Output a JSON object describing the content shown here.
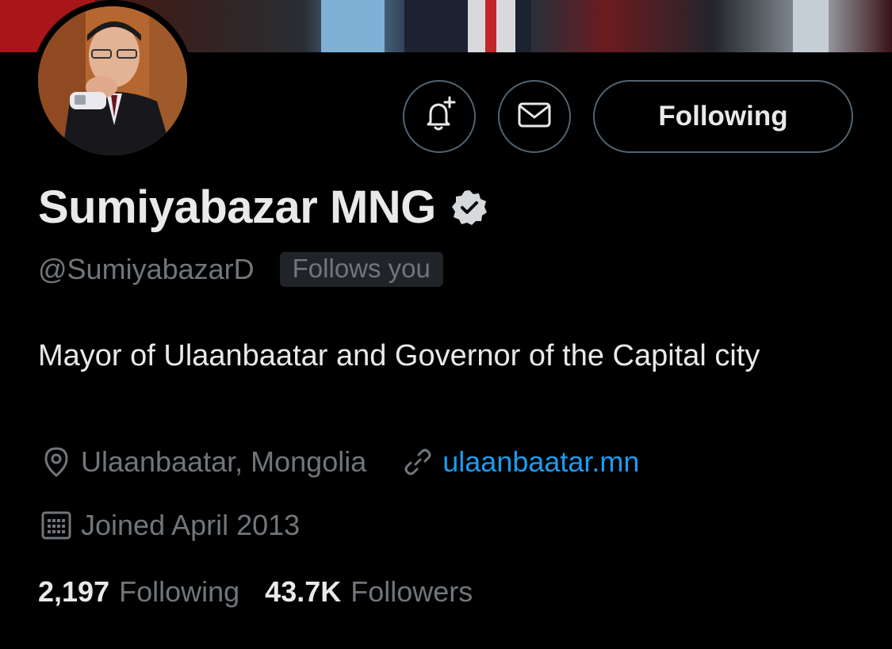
{
  "profile": {
    "display_name": "Sumiyabazar MNG",
    "handle": "@SumiyabazarD",
    "follows_you": "Follows you",
    "bio": "Mayor of Ulaanbaatar and Governor of the Capital city",
    "location": "Ulaanbaatar, Mongolia",
    "website": "ulaanbaatar.mn",
    "joined": "Joined April 2013"
  },
  "actions": {
    "notify_icon": "bell-plus-icon",
    "message_icon": "envelope-icon",
    "following_label": "Following"
  },
  "stats": {
    "following_count": "2,197",
    "following_label": "Following",
    "followers_count": "43.7K",
    "followers_label": "Followers"
  },
  "icons": {
    "verified": "verified-badge-icon",
    "location": "location-pin-icon",
    "link": "link-icon",
    "calendar": "calendar-icon"
  },
  "colors": {
    "background": "#000000",
    "primary_text": "#e7e9ea",
    "secondary_text": "#71767b",
    "link": "#1d9bf0",
    "border": "#536471"
  }
}
